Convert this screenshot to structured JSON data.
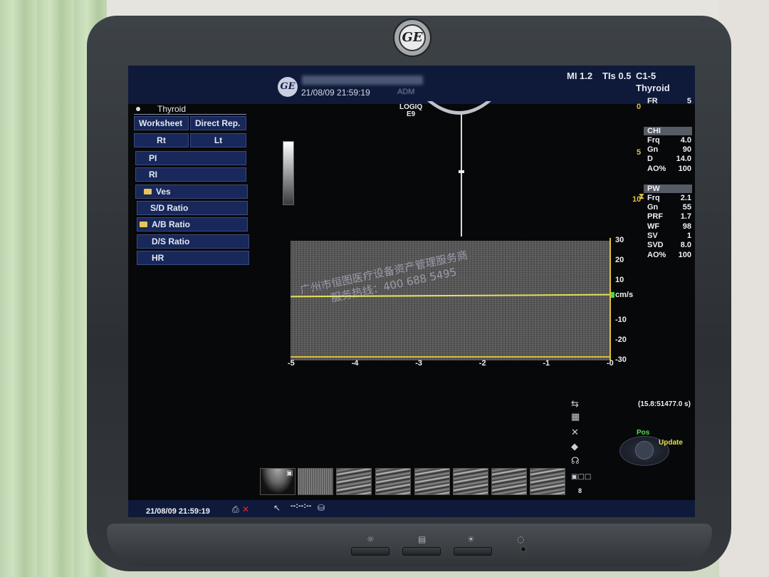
{
  "header": {
    "date_time": "21/08/09 21:59:19",
    "operator": "ADM",
    "mi": "MI 1.2",
    "tis": "TIs 0.5",
    "probe": "C1-5",
    "preset": "Thyroid",
    "logo": "GE"
  },
  "left_menu": {
    "study": "Thyroid",
    "worksheet": "Worksheet",
    "direct_rep": "Direct Rep.",
    "rt": "Rt",
    "lt": "Lt",
    "items": [
      "PI",
      "RI",
      "Ves",
      "S/D Ratio",
      "A/B Ratio",
      "D/S Ratio",
      "HR"
    ]
  },
  "image": {
    "system_label_line1": "LOGIQ",
    "system_label_line2": "E9",
    "depth_ticks": [
      "0",
      "5",
      "10"
    ]
  },
  "params": {
    "fr_label": "FR",
    "fr_value": "5",
    "chi_header": "CHI",
    "chi": [
      {
        "label": "Frq",
        "value": "4.0"
      },
      {
        "label": "Gn",
        "value": "90"
      },
      {
        "label": "D",
        "value": "14.0"
      },
      {
        "label": "AO%",
        "value": "100"
      }
    ],
    "pw_header": "PW",
    "pw": [
      {
        "label": "Frq",
        "value": "2.1"
      },
      {
        "label": "Gn",
        "value": "55"
      },
      {
        "label": "PRF",
        "value": "1.7"
      },
      {
        "label": "WF",
        "value": "98"
      },
      {
        "label": "SV",
        "value": "1"
      },
      {
        "label": "SVD",
        "value": "8.0"
      },
      {
        "label": "AO%",
        "value": "100"
      }
    ]
  },
  "chart_data": {
    "type": "area",
    "title": "",
    "xlabel": "",
    "ylabel": "cm/s",
    "x_ticks": [
      "-5",
      "-4",
      "-3",
      "-2",
      "-1",
      "-0"
    ],
    "y_ticks": [
      "30",
      "20",
      "10",
      "-10",
      "-20",
      "-30"
    ],
    "xlim": [
      -5,
      0
    ],
    "ylim": [
      -30,
      30
    ],
    "baseline": 0
  },
  "watermark": {
    "line1": "广州市恒图医疗设备资产管理服务商",
    "line2": "服务热线：400 688 5495"
  },
  "footer": {
    "frame_time": "(15.8:51477.0 s)",
    "pos": "Pos",
    "update": "Update",
    "page": "8",
    "status_date": "21/08/09 21:59:19",
    "status_time": "--:--:--"
  },
  "icons": [
    "swap-icon",
    "keyboard-icon",
    "tools-icon",
    "arrows-icon",
    "probe-icon",
    "printer-icon",
    "network-error-icon",
    "disk-icon"
  ]
}
